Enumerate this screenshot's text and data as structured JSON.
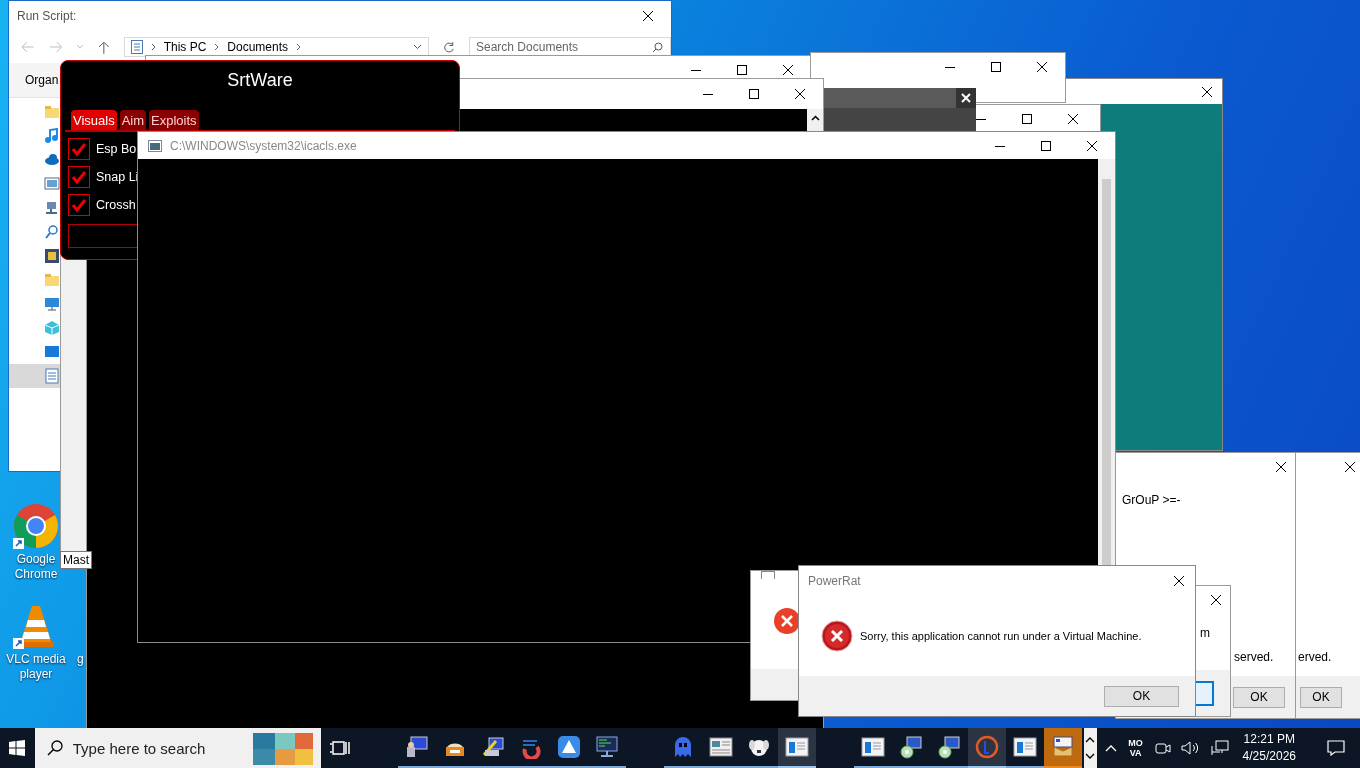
{
  "desktop": {
    "icons": [
      {
        "kind": "chrome",
        "label": "Google Chrome"
      },
      {
        "kind": "vlc",
        "label": "VLC media player"
      },
      {
        "kind": "partial",
        "label": "g"
      }
    ]
  },
  "explorer": {
    "title": "Run Script:",
    "breadcrumb": [
      "This PC",
      "Documents"
    ],
    "search": {
      "placeholder": "Search Documents"
    },
    "ribbon_tab": "Organ",
    "nav_items": [
      {
        "kind": "folder",
        "selected": false
      },
      {
        "kind": "music",
        "selected": false
      },
      {
        "kind": "cloud",
        "selected": false
      },
      {
        "kind": "pictures",
        "selected": false
      },
      {
        "kind": "network",
        "selected": false
      },
      {
        "kind": "search",
        "selected": false
      },
      {
        "kind": "film",
        "selected": false
      },
      {
        "kind": "folder",
        "selected": false
      },
      {
        "kind": "monitor",
        "selected": false
      },
      {
        "kind": "cube",
        "selected": false
      },
      {
        "kind": "desktop",
        "selected": false
      },
      {
        "kind": "document",
        "selected": true
      }
    ]
  },
  "srtware": {
    "title": "SrtWare",
    "tabs": [
      {
        "label": "Visuals",
        "selected": true
      },
      {
        "label": "Aim",
        "selected": false
      },
      {
        "label": "Exploits",
        "selected": false
      }
    ],
    "options": [
      {
        "label": "Esp Bo",
        "checked": true
      },
      {
        "label": "Snap Li",
        "checked": true
      },
      {
        "label": "Crossh",
        "checked": true
      }
    ]
  },
  "tooltip": "Mast",
  "console": {
    "title": "C:\\WINDOWS\\system32\\icacls.exe"
  },
  "dialog_right_1": {
    "line_1": "GrOuP >=-",
    "line_2": "served.",
    "button": "OK"
  },
  "dialog_right_2": {
    "line_2": "erved.",
    "button": "OK"
  },
  "dialog_middle": {
    "line_1": "m"
  },
  "powerrat": {
    "title": "PowerRat",
    "message": "Sorry, this application cannot run under a Virtual Machine.",
    "button": "OK"
  },
  "taskbar": {
    "search": {
      "placeholder": "Type here to search"
    },
    "app_groups": [
      [
        {
          "kind": "computer",
          "active": false,
          "flashing": false
        },
        {
          "kind": "cake",
          "active": false,
          "flashing": false
        },
        {
          "kind": "wrench",
          "active": false,
          "flashing": false
        },
        {
          "kind": "swirl",
          "active": false,
          "flashing": false
        },
        {
          "kind": "triangle",
          "active": false,
          "flashing": false
        },
        {
          "kind": "terminal",
          "active": false,
          "flashing": false
        }
      ],
      [
        {
          "kind": "ghost",
          "active": false,
          "flashing": false
        },
        {
          "kind": "window",
          "active": false,
          "flashing": false
        },
        {
          "kind": "dog",
          "active": false,
          "flashing": false
        },
        {
          "kind": "bluewindow",
          "active": true,
          "flashing": false
        }
      ],
      [
        {
          "kind": "bluewindow",
          "active": false,
          "flashing": false
        },
        {
          "kind": "disc",
          "active": false,
          "flashing": false
        },
        {
          "kind": "disc",
          "active": false,
          "flashing": false
        },
        {
          "kind": "ring",
          "active": true,
          "flashing": false
        },
        {
          "kind": "bluewindow",
          "active": false,
          "flashing": false
        },
        {
          "kind": "package",
          "active": false,
          "flashing": true
        }
      ]
    ],
    "input_indicator": "MO VA",
    "clock": {
      "time": "12:21 PM",
      "date": "4/25/2026"
    }
  }
}
